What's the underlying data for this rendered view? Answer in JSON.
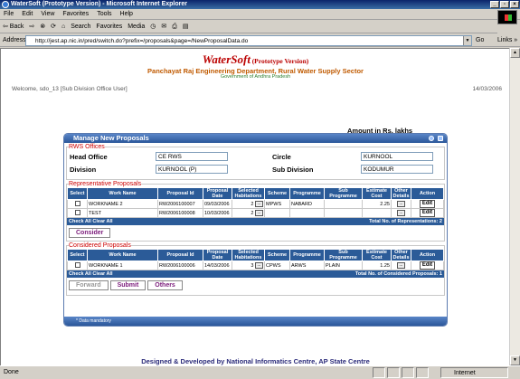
{
  "window": {
    "title": "WaterSoft (Prototype Version) - Microsoft Internet Explorer"
  },
  "menu": [
    "File",
    "Edit",
    "View",
    "Favorites",
    "Tools",
    "Help"
  ],
  "toolbar": {
    "back": "⇦ Back",
    "forward": "⇨",
    "stop": "⊗",
    "refresh": "⟳",
    "home": "⌂",
    "search": "Search",
    "favorites": "Favorites",
    "media": "Media",
    "history": "◷",
    "mail": "✉",
    "print": "⎙",
    "edit": "▤"
  },
  "address": {
    "label": "Address",
    "url": "http://jest.ap.nic.in/pred/switch.do?prefix=/proposals&page=/NewProposalData.do",
    "go": "Go",
    "links": "Links »"
  },
  "header": {
    "brand": "WaterSoft",
    "prototype": "(Prototype Version)",
    "dept": "Panchayat Raj Engineering Department, Rural Water Supply Sector",
    "govt": "Government of Andhra Pradesh",
    "welcome": "Welcome, sdo_13 [Sub Division Office User]",
    "date": "14/03/2006"
  },
  "amount_note": "Amount in Rs. lakhs",
  "panel": {
    "title": "Manage New Proposals",
    "offices": {
      "legend": "RWS Offices",
      "head_office_label": "Head Office",
      "head_office": "CE RWS",
      "circle_label": "Circle",
      "circle": "KURNOOL",
      "division_label": "Division",
      "division": "KURNOOL (P)",
      "subdivision_label": "Sub Division",
      "subdivision": "KODUMUR"
    },
    "columns": [
      "Select",
      "Work Name",
      "Proposal Id",
      "Proposal Date",
      "Selected Habitations",
      "Scheme",
      "Programme",
      "Sub Programme",
      "Estimate Cost",
      "Other Details",
      "Action"
    ],
    "representative": {
      "legend": "Representative Proposals",
      "rows": [
        {
          "work": "WORKNAME 2",
          "id": "RW2006100007",
          "date": "09/03/2006",
          "hab": "2",
          "scheme": "MPWS",
          "prog": "NABARD",
          "sub": "",
          "cost": "2.25",
          "action": "Edit"
        },
        {
          "work": "TEST",
          "id": "RW2006100008",
          "date": "10/03/2006",
          "hab": "2",
          "scheme": "",
          "prog": "",
          "sub": "",
          "cost": "",
          "action": "Edit"
        }
      ],
      "check_all": "Check All",
      "clear_all": "Clear All",
      "total": "Total No. of Representations: 2",
      "consider": "Consider"
    },
    "considered": {
      "legend": "Considered Proposals",
      "rows": [
        {
          "work": "WORKNAME 1",
          "id": "RW2006100006",
          "date": "14/03/2006",
          "hab": "3",
          "scheme": "CPWS",
          "prog": "ARWS",
          "sub": "PLAIN",
          "cost": "1.25",
          "action": "Edit"
        }
      ],
      "check_all": "Check All",
      "clear_all": "Clear All",
      "total": "Total No. of Considered Proposals: 1"
    },
    "buttons": {
      "forward": "Forward",
      "submit": "Submit",
      "others": "Others"
    },
    "mandatory": "* Data mandatory"
  },
  "footer": "Designed & Developed by National Informatics Centre, AP State Centre",
  "status": {
    "text": "Done",
    "zone": "Internet"
  },
  "dots": "..."
}
